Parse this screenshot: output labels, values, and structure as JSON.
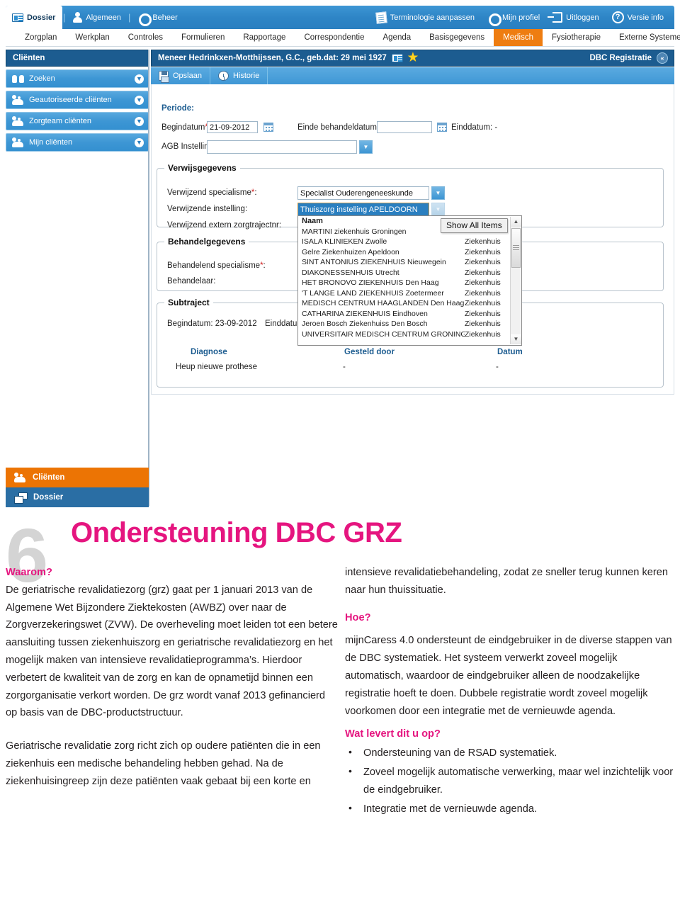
{
  "app": {
    "ribbon": {
      "tab_dossier": "Dossier",
      "item_algemeen": "Algemeen",
      "item_beheer": "Beheer",
      "separator": "|",
      "right_items": [
        {
          "label": "Terminologie aanpassen",
          "icon": "document-icon"
        },
        {
          "label": "Mijn profiel",
          "icon": "gear-icon"
        },
        {
          "label": "Uitloggen",
          "icon": "logout-icon"
        },
        {
          "label": "Versie info",
          "icon": "help-icon"
        }
      ]
    },
    "tabs": [
      {
        "label": "Zorgplan",
        "active": false
      },
      {
        "label": "Werkplan",
        "active": false
      },
      {
        "label": "Controles",
        "active": false
      },
      {
        "label": "Formulieren",
        "active": false
      },
      {
        "label": "Rapportage",
        "active": false
      },
      {
        "label": "Correspondentie",
        "active": false
      },
      {
        "label": "Agenda",
        "active": false
      },
      {
        "label": "Basisgegevens",
        "active": false
      },
      {
        "label": "Medisch",
        "active": true
      },
      {
        "label": "Fysiotherapie",
        "active": false
      },
      {
        "label": "Externe Systemen",
        "active": false
      }
    ],
    "sidebar": {
      "title": "Cliënten",
      "items": [
        {
          "label": "Zoeken",
          "icon": "binoculars-icon"
        },
        {
          "label": "Geautoriseerde cliënten",
          "icon": "people-icon"
        },
        {
          "label": "Zorgteam cliënten",
          "icon": "people-icon"
        },
        {
          "label": "Mijn cliënten",
          "icon": "people-star-icon"
        }
      ],
      "modules": [
        {
          "label": "Cliënten",
          "icon": "people-icon",
          "active": true
        },
        {
          "label": "Dossier",
          "icon": "folder-icon",
          "active": false
        }
      ]
    },
    "patient_header": {
      "name": "Meneer Hedrinkxen-Motthijssen, G.C., geb.dat: 29 mei 1927",
      "right_label": "DBC Registratie"
    },
    "toolbar": {
      "save_label": "Opslaan",
      "history_label": "Historie"
    },
    "form": {
      "periode_title": "Periode:",
      "begindatum_label": "Begindatum",
      "begindatum_value": "21-09-2012",
      "einde_behandeldatum_label": "Einde behandeldatum:",
      "einde_behandeldatum_value": "",
      "einddatum_label": "Einddatum: -",
      "agb_label": "AGB Instelling:",
      "agb_value": "",
      "required_mark": "*"
    },
    "verwijsgegevens": {
      "legend": "Verwijsgegevens",
      "specialisme_label": "Verwijzend specialisme",
      "specialisme_value": "Specialist Ouderengeneeskunde",
      "instelling_label": "Verwijzende instelling:",
      "instelling_value": "Thuiszorg instelling APELDOORN",
      "zorgtrajectnr_label": "Verwijzend extern zorgtrajectnr:"
    },
    "behandelgegevens": {
      "legend": "Behandelgegevens",
      "specialisme_label": "Behandelend specialisme",
      "behandelaar_label": "Behandelaar:"
    },
    "subtraject": {
      "legend": "Subtraject",
      "begindatum": "Begindatum: 23-09-2012",
      "einddatum": "Einddatum"
    },
    "diagnose_table": {
      "headers": [
        "Diagnose",
        "Gesteld door",
        "Datum"
      ],
      "rows": [
        [
          "Heup nieuwe prothese",
          "-",
          "-"
        ]
      ]
    },
    "dropdown": {
      "tooltip": "Show All Items",
      "header": {
        "name": "Naam",
        "type": ""
      },
      "rows": [
        {
          "name": "MARTINI ziekenhuis Groningen",
          "type": ""
        },
        {
          "name": "ISALA KLINIEKEN Zwolle",
          "type": "Ziekenhuis"
        },
        {
          "name": "Gelre Ziekenhuizen Apeldoon",
          "type": "Ziekenhuis"
        },
        {
          "name": "SINT ANTONIUS ZIEKENHUIS Nieuwegein",
          "type": "Ziekenhuis"
        },
        {
          "name": "DIAKONESSENHUIS Utrecht",
          "type": "Ziekenhuis"
        },
        {
          "name": "HET BRONOVO ZIEKENHUIS Den Haag",
          "type": "Ziekenhuis"
        },
        {
          "name": "'T LANGE LAND ZIEKENHUIS Zoetermeer",
          "type": "Ziekenhuis"
        },
        {
          "name": "MEDISCH CENTRUM HAAGLANDEN Den Haag",
          "type": "Ziekenhuis"
        },
        {
          "name": "CATHARINA ZIEKENHUIS Eindhoven",
          "type": "Ziekenhuis"
        },
        {
          "name": "Jeroen Bosch Ziekenhuiss Den Bosch",
          "type": "Ziekenhuis"
        },
        {
          "name": "UNIVERSITAIR MEDISCH CENTRUM GRONINGEN",
          "type": "Ziekenhuis"
        }
      ]
    },
    "colors": {
      "ribbon_blue": "#2e85c6",
      "active_tab_orange": "#ee7d11",
      "header_dark_blue": "#1c5c90",
      "module_orange": "#ec7404"
    }
  },
  "document": {
    "section_number": "6",
    "title": "Ondersteuning DBC GRZ",
    "accent_color": "#e5157f",
    "left": {
      "heading": "Waarom?",
      "paragraph1": "De geriatrische revalidatiezorg (grz) gaat per 1 januari 2013 van de Algemene Wet Bijzondere Ziektekosten (AWBZ) over naar de Zorgverzekeringswet (ZVW). De overheveling moet leiden tot een betere aansluiting tussen ziekenhuiszorg en geriatrische revalidatiezorg en het mogelijk maken van intensieve revalidatieprogramma’s. Hierdoor verbetert de kwaliteit van de zorg en kan de opnametijd binnen een zorgorganisatie verkort worden. De grz wordt vanaf 2013 gefinancierd op basis van de DBC-productstructuur.",
      "paragraph2": "Geriatrische revalidatie zorg richt zich op oudere patiënten die in een ziekenhuis een medische behandeling hebben gehad. Na de ziekenhuisingreep zijn deze patiënten vaak gebaat bij een korte en"
    },
    "right": {
      "continuation": "intensieve revalidatiebehandeling, zodat ze sneller terug kunnen keren naar hun thuissituatie.",
      "heading_hoe": "Hoe?",
      "paragraph_hoe": "mijnCaress 4.0 ondersteunt de eindgebruiker in de diverse stappen van de DBC systematiek. Het systeem verwerkt zoveel mogelijk automatisch, waardoor de eindgebruiker alleen de noodzakelijke registratie hoeft te doen. Dubbele registratie wordt zoveel mogelijk voorkomen door een integratie met de vernieuwde agenda.",
      "heading_oplevert": "Wat levert dit u op?",
      "bullets": [
        "Ondersteuning van de RSAD systematiek.",
        "Zoveel mogelijk automatische verwerking, maar wel inzichtelijk voor de eindgebruiker.",
        "Integratie met de vernieuwde agenda."
      ]
    }
  }
}
